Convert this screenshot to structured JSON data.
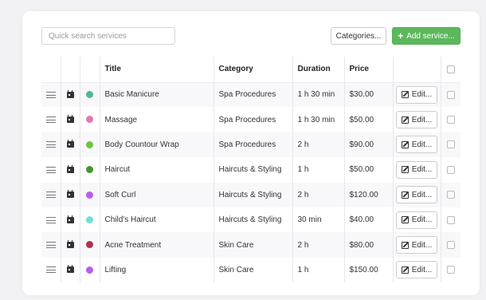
{
  "search": {
    "placeholder": "Quick search services",
    "value": ""
  },
  "toolbar": {
    "categories_label": "Categories...",
    "add_label": "Add service...",
    "add_icon": "plus-icon"
  },
  "colors": {
    "accent_green": "#5cb85c"
  },
  "table": {
    "columns": [
      "Title",
      "Category",
      "Duration",
      "Price"
    ],
    "edit_label": "Edit...",
    "rows": [
      {
        "title": "Basic Manicure",
        "category": "Spa Procedures",
        "duration": "1 h 30 min",
        "price": "$30.00",
        "color": "#4db899"
      },
      {
        "title": "Massage",
        "category": "Spa Procedures",
        "duration": "1 h 30 min",
        "price": "$50.00",
        "color": "#e07ab1"
      },
      {
        "title": "Body Countour Wrap",
        "category": "Spa Procedures",
        "duration": "2 h",
        "price": "$90.00",
        "color": "#6bc63a"
      },
      {
        "title": "Haircut",
        "category": "Haircuts & Styling",
        "duration": "1 h",
        "price": "$50.00",
        "color": "#3f9a2c"
      },
      {
        "title": "Soft Curl",
        "category": "Haircuts & Styling",
        "duration": "2 h",
        "price": "$120.00",
        "color": "#b85ef0"
      },
      {
        "title": "Child's Haircut",
        "category": "Haircuts & Styling",
        "duration": "30 min",
        "price": "$40.00",
        "color": "#6ee0d4"
      },
      {
        "title": "Acne Treatment",
        "category": "Skin Care",
        "duration": "2 h",
        "price": "$80.00",
        "color": "#b0304c"
      },
      {
        "title": "Lifting",
        "category": "Skin Care",
        "duration": "1 h",
        "price": "$150.00",
        "color": "#b85ef0"
      }
    ]
  }
}
